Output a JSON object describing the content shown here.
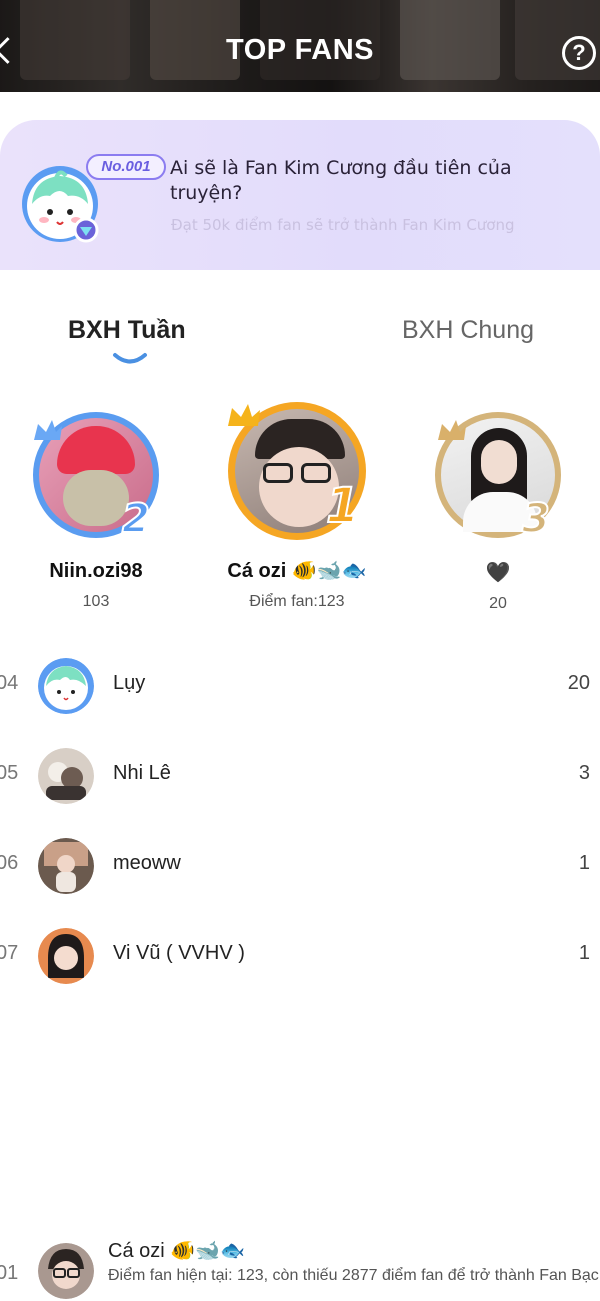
{
  "header": {
    "title": "TOP FANS",
    "help_label": "?"
  },
  "banner": {
    "badge": "No.001",
    "title": "Ai sẽ là Fan Kim Cương đầu tiên của truyện?",
    "subtitle": "Đạt 50k điểm fan sẽ trở thành Fan Kim Cương"
  },
  "tabs": [
    {
      "label": "BXH Tuần",
      "active": true
    },
    {
      "label": "BXH Chung",
      "active": false
    }
  ],
  "podium": [
    {
      "rank": "2",
      "name": "Niin.ozi98",
      "score": "103",
      "ring_color": "#5a9cf0"
    },
    {
      "rank": "1",
      "name": "Cá ozi 🐠🐋🐟",
      "score": "Điểm fan:123",
      "ring_color": "#f5a623"
    },
    {
      "rank": "3",
      "name": "🖤",
      "score": "20",
      "ring_color": "#d4b47a"
    }
  ],
  "list": [
    {
      "rank": "04",
      "name": "Lụy",
      "points": "20"
    },
    {
      "rank": "05",
      "name": "Nhi Lê",
      "points": "3"
    },
    {
      "rank": "06",
      "name": "meoww",
      "points": "1"
    },
    {
      "rank": "07",
      "name": "Vi Vũ ( VVHV )",
      "points": "1"
    }
  ],
  "current_user": {
    "rank": "01",
    "name": "Cá ozi 🐠🐋🐟",
    "description": "Điểm fan hiện tại: 123, còn thiếu 2877 điểm fan để trở thành Fan Bạc"
  }
}
